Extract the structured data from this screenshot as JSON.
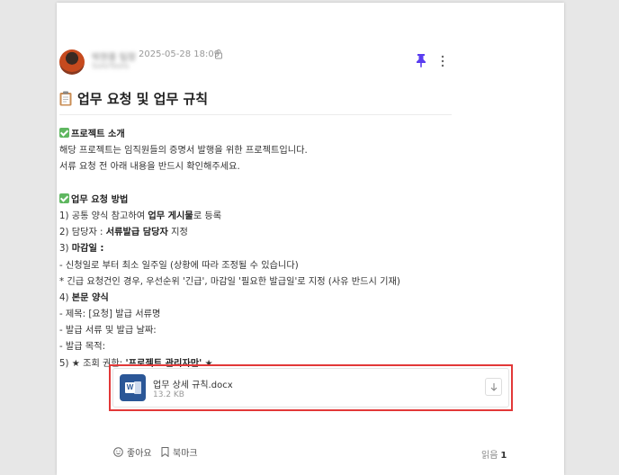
{
  "post": {
    "author_name": "박현풍 팀장",
    "author_sub": "SoloTools",
    "timestamp": "2025-05-28 18:09",
    "title": "업무 요청 및 업무 규칙"
  },
  "content": {
    "section1_heading": "프로젝트 소개",
    "section1_line1": "해당 프로젝트는 임직원들의 증명서 발행을 위한 프로젝트입니다.",
    "section1_line2": "서류 요청 전 아래 내용을 반드시 확인해주세요.",
    "section2_heading": "업무 요청 방법",
    "item1_pre": "1) 공통 양식 참고하여 ",
    "item1_bold": "업무 게시물",
    "item1_post": "로 등록",
    "item2_pre": "2) 담당자 : ",
    "item2_bold": "서류발급 담당자",
    "item2_post": " 지정",
    "item3_pre": "3) ",
    "item3_bold": "마감일 :",
    "item3_sub1": "- 신청일로 부터 최소 일주일 (상황에 따라 조정될 수 있습니다)",
    "item3_sub2": "* 긴급 요청건인 경우, 우선순위 '긴급', 마감일 '필요한 발급일'로 지정 (사유 반드시 기재)",
    "item4_pre": "4) ",
    "item4_bold": "본문 양식",
    "item4_sub1": "- 제목:  [요청] 발급 서류명",
    "item4_sub2": "- 발급 서류 및 발급 날짜:",
    "item4_sub3": "- 발급 목적:",
    "item5_pre": "5) ★ 조회 권한: ",
    "item5_bold": "'프로젝트 관리자만'",
    "item5_post": " ★"
  },
  "attachment": {
    "filename": "업무 상세 규칙.docx",
    "size": "13.2 KB",
    "icon_letter": "W"
  },
  "footer": {
    "like_label": "좋아요",
    "bookmark_label": "북마크",
    "read_label": "읽음",
    "read_count": "1"
  },
  "colors": {
    "accent_pin": "#5a3df0",
    "highlight_border": "#e23838",
    "check_green": "#5fb760",
    "word_blue": "#2b5797"
  },
  "icons": [
    "lock-icon",
    "pin-icon",
    "more-icon",
    "clipboard-icon",
    "check-icon",
    "word-file-icon",
    "download-icon",
    "smile-icon",
    "bookmark-icon"
  ]
}
